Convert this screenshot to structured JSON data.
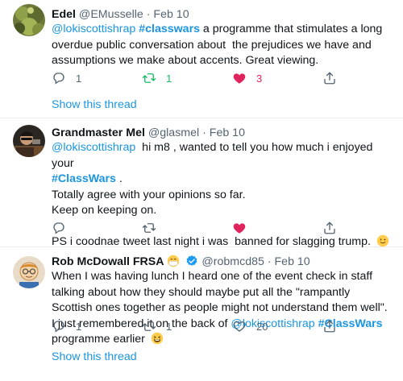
{
  "tweets": [
    {
      "name": "Edel",
      "handle": "@EMusselle",
      "separator": "·",
      "date": "Feb 10",
      "mention": "@lokiscottishrap",
      "hashtag": "#classwars",
      "text": " a programme that stimulates a long overdue public conversation about  the prejudices we have and assumptions we make about accents. Great viewing.",
      "reply_count": "1",
      "retweet_count": "1",
      "like_count": "3",
      "show_thread": "Show this thread"
    },
    {
      "name": "Grandmaster Mel",
      "handle": "@glasmel",
      "separator": "·",
      "date": "Feb 10",
      "mention": "@lokiscottishrap",
      "text_after_mention": "  hi m8 , wanted to tell you how much i enjoyed your",
      "hashtag": "#ClassWars",
      "text_after_hashtag": " .",
      "line3": "Totally agree with your opinions so far.",
      "line4": "Keep on keeping on.",
      "line6": "PS i coodnae tweet last night i was  banned for slagging trump. ",
      "reply_count": "",
      "retweet_count": "",
      "like_count": ""
    },
    {
      "name": "Rob McDowall FRSA",
      "handle": "@robmcd85",
      "separator": "·",
      "date": "Feb 10",
      "text": "When I was having lunch I heard one of the event check in staff talking about how they should maybe put all the \"rampantly Scottish ones together as people might not understand them well\". I just remembered it on the back of ",
      "mention": "@lokiscottishrap",
      "hashtag": "#ClassWars",
      "text_after": " programme earlier ",
      "reply_count": "1",
      "retweet_count": "1",
      "like_count": "20",
      "show_thread": "Show this thread"
    }
  ],
  "icons": {
    "reply": "reply-icon",
    "retweet": "retweet-icon",
    "like": "heart-icon",
    "share": "share-icon",
    "verified": "verified-badge-icon"
  },
  "colors": {
    "link": "#1b95e0",
    "retweet_active": "#17bf63",
    "like_active": "#e0245e",
    "secondary": "#536471"
  }
}
